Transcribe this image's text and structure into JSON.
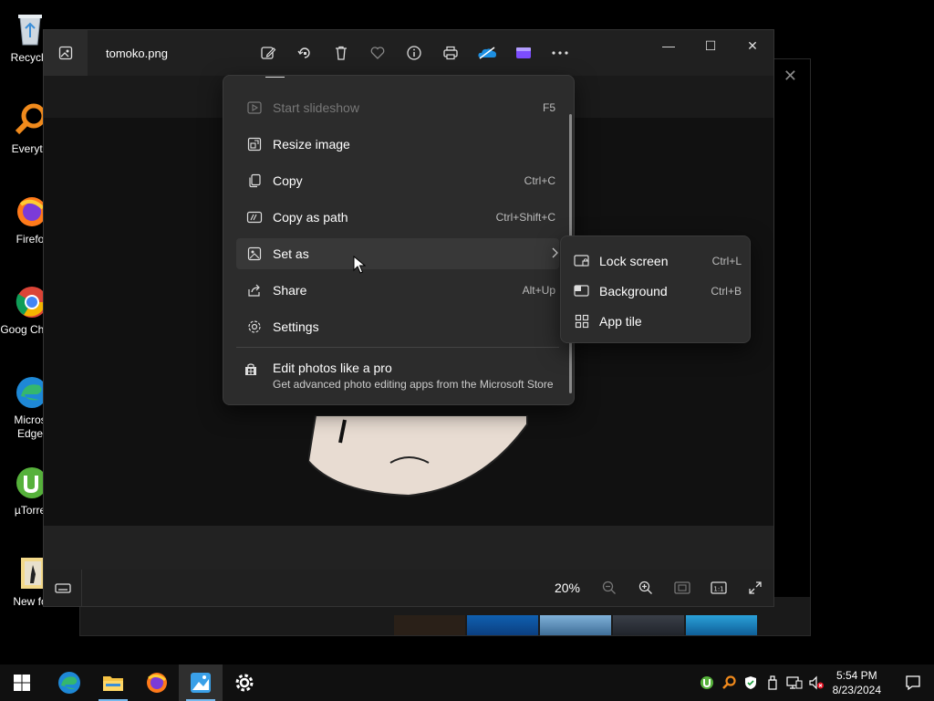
{
  "desktop": {
    "icons": [
      {
        "label": "Recycle",
        "icon": "recycle-bin-icon"
      },
      {
        "label": "Everyth",
        "icon": "everything-search-icon"
      },
      {
        "label": "Firefo",
        "icon": "firefox-icon"
      },
      {
        "label": "Goog Chron",
        "icon": "chrome-icon"
      },
      {
        "label": "Micros Edge",
        "icon": "edge-icon"
      },
      {
        "label": "µTorre",
        "icon": "utorrent-icon"
      },
      {
        "label": "New fo",
        "icon": "folder-icon"
      }
    ]
  },
  "app": {
    "file_name": "tomoko.png",
    "toolbar": [
      "edit-icon",
      "rotate-icon",
      "delete-icon",
      "favorite-icon",
      "info-icon",
      "print-icon",
      "onedrive-icon",
      "clipchamp-icon",
      "more-icon"
    ],
    "window_controls": {
      "minimize": "—",
      "maximize": "☐",
      "close": "✕"
    },
    "zoom": "20%"
  },
  "context_menu": {
    "items": [
      {
        "label": "Start slideshow",
        "shortcut": "F5",
        "icon": "slideshow-icon",
        "disabled": true
      },
      {
        "label": "Resize image",
        "shortcut": "",
        "icon": "resize-icon"
      },
      {
        "label": "Copy",
        "shortcut": "Ctrl+C",
        "icon": "copy-icon"
      },
      {
        "label": "Copy as path",
        "shortcut": "Ctrl+Shift+C",
        "icon": "copy-path-icon"
      },
      {
        "label": "Set as",
        "shortcut": "",
        "icon": "set-as-icon",
        "submenu": true
      },
      {
        "label": "Share",
        "shortcut": "Alt+Up",
        "icon": "share-icon"
      },
      {
        "label": "Settings",
        "shortcut": "",
        "icon": "settings-icon"
      }
    ],
    "promo": {
      "title": "Edit photos like a pro",
      "subtitle": "Get advanced photo editing apps from the Microsoft Store"
    }
  },
  "submenu": {
    "items": [
      {
        "label": "Lock screen",
        "shortcut": "Ctrl+L",
        "icon": "lock-screen-icon"
      },
      {
        "label": "Background",
        "shortcut": "Ctrl+B",
        "icon": "background-icon"
      },
      {
        "label": "App tile",
        "shortcut": "",
        "icon": "app-tile-icon"
      }
    ]
  },
  "taskbar": {
    "time": "5:54 PM",
    "date": "8/23/2024"
  }
}
